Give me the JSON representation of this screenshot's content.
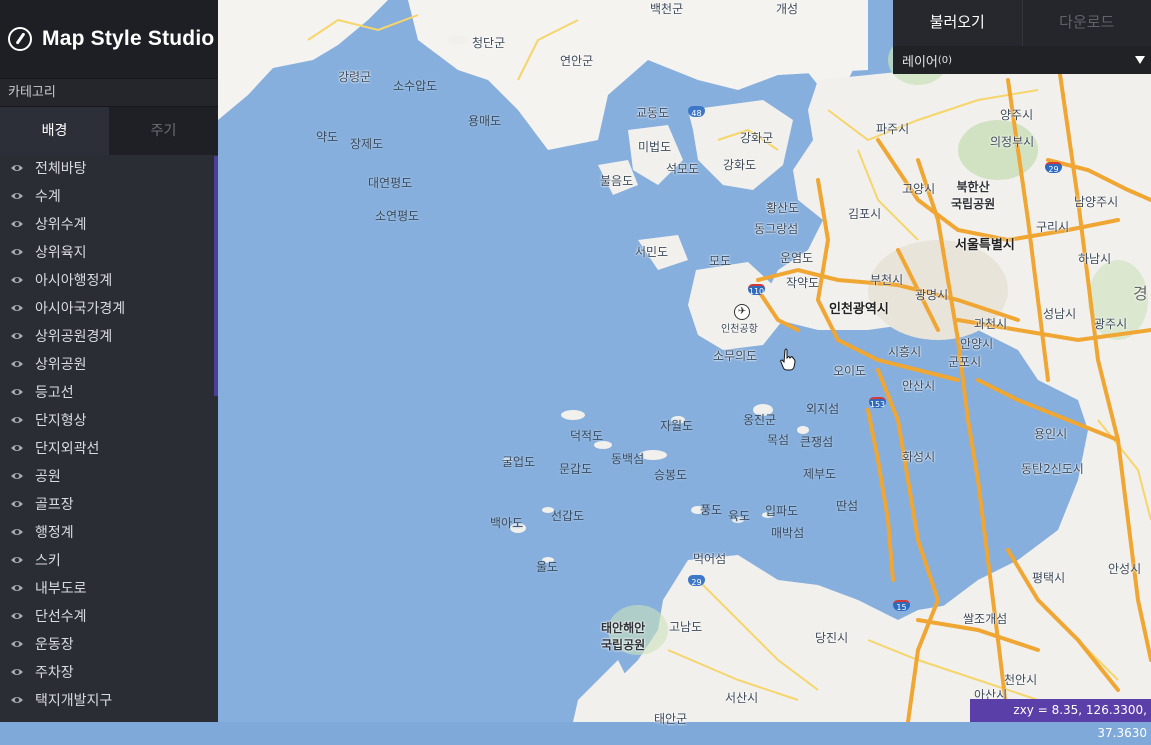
{
  "app": {
    "title": "Map Style Studio"
  },
  "sidebar": {
    "category_label": "카테고리",
    "tabs": [
      {
        "label": "배경"
      },
      {
        "label": "주기"
      }
    ],
    "layers": [
      "전체바탕",
      "수계",
      "상위수계",
      "상위육지",
      "아시아행정계",
      "아시아국가경계",
      "상위공원경계",
      "상위공원",
      "등고선",
      "단지형상",
      "단지외곽선",
      "공원",
      "골프장",
      "행정계",
      "스키",
      "내부도로",
      "단선수계",
      "운동장",
      "주차장",
      "택지개발지구"
    ]
  },
  "top_panel": {
    "load_label": "불러오기",
    "download_label": "다운로드",
    "layer_dropdown": {
      "label": "레이어",
      "count": "(0)"
    }
  },
  "coords": {
    "text": "zxy = 8.35, 126.3300, 37.3630"
  },
  "map": {
    "labels": {
      "baekcheon": "백천군",
      "gaesung": "개성",
      "cheongdan": "청단군",
      "yeonan": "연안군",
      "ganglyeong": "강령군",
      "sosuapdo": "소수압도",
      "yongmaedo": "용매도",
      "yakdo": "약도",
      "jangjaedo": "장제도",
      "daeyeonpyeong": "대연평도",
      "soyeonpyeong": "소연평도",
      "gyodongdo": "교동도",
      "mibeopdo": "미법도",
      "seokmodo": "석모도",
      "bureumdo": "불음도",
      "ganghwagun": "강화군",
      "ganghwado": "강화도",
      "hwangsando": "황산도",
      "donggeomdo": "동그랑섬",
      "paju": "파주시",
      "yangju": "양주시",
      "uijeongbu": "의정부시",
      "goyang": "고양시",
      "bukhansan": "북한산\n국립공원",
      "gimpo": "김포시",
      "namyangju": "남양주시",
      "guri": "구리시",
      "seoul": "서울특별시",
      "hanam": "하남시",
      "seomindo": "서민도",
      "modo": "모도",
      "unyeomdo": "운염도",
      "jakyakdo": "작약도",
      "bucheon": "부천시",
      "incheon": "인천광역시",
      "gwangmyeong": "광명시",
      "seongnam": "성남시",
      "gwangju": "광주시",
      "gwacheon": "과천시",
      "incheon_airport": "인천공항",
      "anyang": "안양시",
      "siheung": "시흥시",
      "gunpo": "군포시",
      "somuuido": "소무의도",
      "oido": "오이도",
      "ansan": "안산시",
      "jawoldo": "자월도",
      "yeongheung": "옹진군",
      "oejido": "외지섬",
      "deokjeokdo": "덕적도",
      "okdo": "목섬",
      "keunjangdo": "큰쟁섬",
      "gureopdo": "굴업도",
      "mungapdo": "문갑도",
      "dongbaekseom": "동백섬",
      "seungbongdo": "승봉도",
      "jebudo": "제부도",
      "hwaseong": "화성시",
      "yongin": "용인시",
      "dongtan": "동탄2신도시",
      "pungdo": "풍도",
      "yukdo": "육도",
      "ippado": "입파도",
      "ttanseom": "딴섬",
      "baegado": "백아도",
      "seongapdo": "선갑도",
      "maebakseom": "매박섬",
      "ulldo": "울도",
      "meogeoseom": "먹어섬",
      "anseong": "안성시",
      "pyeongtaek": "평택시",
      "taean": "태안해안\n국립공원",
      "gonamdo": "고남도",
      "ssaljogaeseom": "쌀조개섬",
      "dangjin": "당진시",
      "cheonan": "천안시",
      "seosan": "서산시",
      "asan": "아산시",
      "taean2": "태안군",
      "gyeong": "경"
    },
    "shields": {
      "r48": "48",
      "r110": "110",
      "r29a": "29",
      "r153": "153",
      "r29b": "29",
      "r15": "15"
    }
  }
}
